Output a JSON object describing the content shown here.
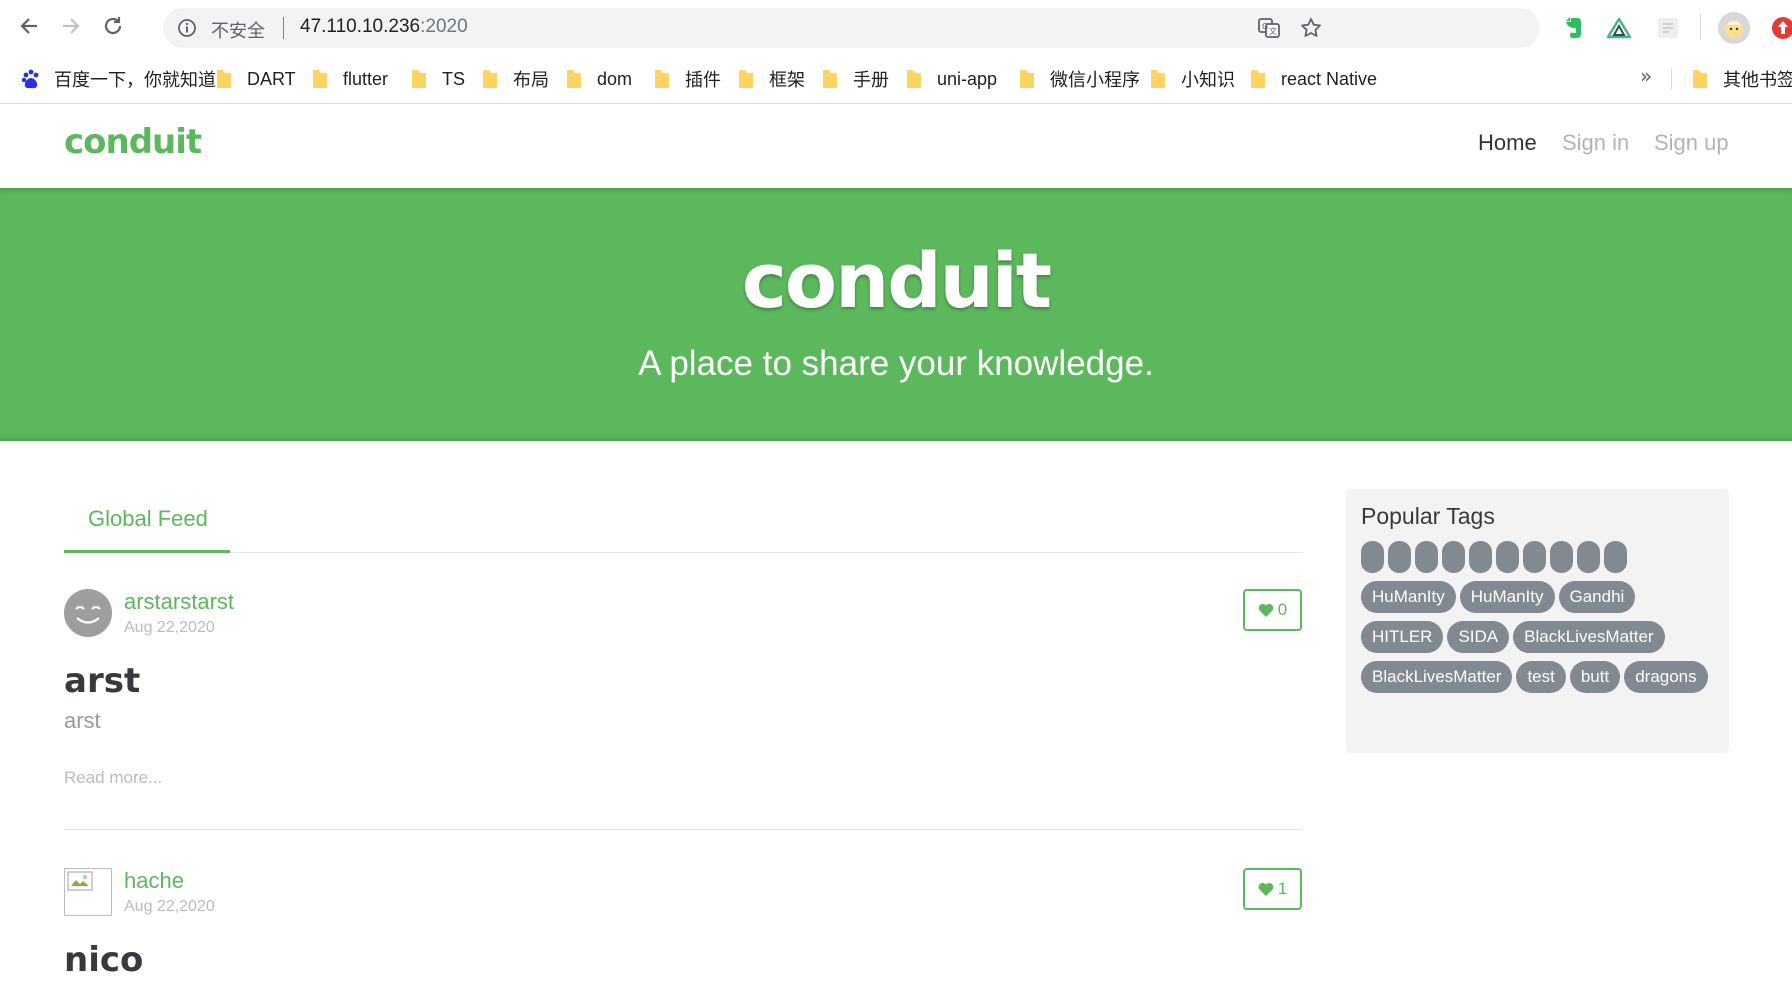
{
  "browser": {
    "insecure_label": "不安全",
    "url_host": "47.110.10.236",
    "url_port": ":2020",
    "bookmarks": [
      {
        "label": "百度一下，你就知道",
        "icon": "baidu-icon"
      },
      {
        "label": "DART",
        "icon": "folder-icon"
      },
      {
        "label": "flutter",
        "icon": "folder-icon"
      },
      {
        "label": "TS",
        "icon": "folder-icon"
      },
      {
        "label": "布局",
        "icon": "folder-icon"
      },
      {
        "label": "dom",
        "icon": "folder-icon"
      },
      {
        "label": "插件",
        "icon": "folder-icon"
      },
      {
        "label": "框架",
        "icon": "folder-icon"
      },
      {
        "label": "手册",
        "icon": "folder-icon"
      },
      {
        "label": "uni-app",
        "icon": "folder-icon"
      },
      {
        "label": "微信小程序",
        "icon": "folder-icon"
      },
      {
        "label": "小知识",
        "icon": "folder-icon"
      },
      {
        "label": "react Native",
        "icon": "folder-icon"
      }
    ],
    "bookmarks_overflow": "»",
    "other_bookmarks": "其他书签"
  },
  "site": {
    "brand": "conduit",
    "nav": {
      "home": "Home",
      "sign_in": "Sign in",
      "sign_up": "Sign up"
    },
    "accent": "#5cb85c"
  },
  "banner": {
    "title": "conduit",
    "subtitle": "A place to share your knowledge."
  },
  "feed": {
    "tab": "Global Feed",
    "articles": [
      {
        "author": "arstarstarst",
        "date": "Aug 22,2020",
        "favorites": "0",
        "title": "arst",
        "description": "arst",
        "read_more": "Read more..."
      },
      {
        "author": "hache",
        "date": "Aug 22,2020",
        "favorites": "1",
        "title": "nico"
      }
    ]
  },
  "sidebar": {
    "title": "Popular Tags",
    "empty_tag_count": 10,
    "tags": [
      "HuManIty",
      "HuManIty",
      "Gandhi",
      "HITLER",
      "SIDA",
      "BlackLivesMatter",
      "BlackLivesMatter",
      "test",
      "butt",
      "dragons"
    ]
  }
}
